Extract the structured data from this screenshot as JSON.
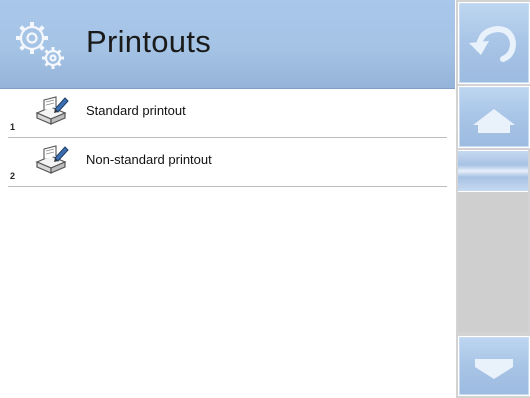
{
  "header": {
    "title": "Printouts",
    "icon": "gears-icon"
  },
  "items": [
    {
      "number": "1",
      "label": "Standard printout",
      "icon": "printer-edit-icon"
    },
    {
      "number": "2",
      "label": "Non-standard printout",
      "icon": "printer-edit-icon"
    }
  ],
  "sidebar": {
    "buttons": [
      "back-arrow-icon",
      "home-icon",
      "scroll-down-icon"
    ]
  },
  "colors": {
    "header_blue": "#a5c3e5",
    "button_blue": "#a8c4e6",
    "sidebar_gray": "#d3d3d3"
  }
}
